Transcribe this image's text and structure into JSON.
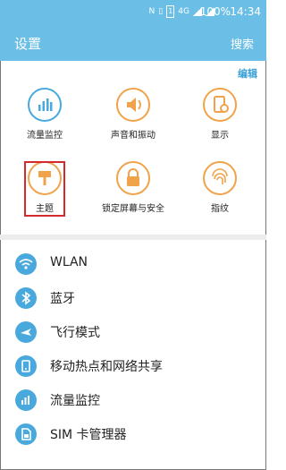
{
  "status_bar": {
    "network_type": "4G",
    "battery": "100%",
    "time": "14:34"
  },
  "header": {
    "title": "设置",
    "search_label": "搜索"
  },
  "top_section": {
    "edit_label": "编辑",
    "tiles": [
      {
        "label": "流量监控",
        "icon": "data-usage-icon",
        "color": "#49a9dd"
      },
      {
        "label": "声音和振动",
        "icon": "speaker-icon",
        "color": "#f0a34a"
      },
      {
        "label": "显示",
        "icon": "display-settings-icon",
        "color": "#f0a34a"
      },
      {
        "label": "主题",
        "icon": "theme-brush-icon",
        "color": "#f0a34a"
      },
      {
        "label": "锁定屏幕与安全",
        "icon": "lock-icon",
        "color": "#f0a34a"
      },
      {
        "label": "指纹",
        "icon": "fingerprint-icon",
        "color": "#f0a34a"
      }
    ]
  },
  "list": [
    {
      "label": "WLAN",
      "icon": "wifi-icon"
    },
    {
      "label": "蓝牙",
      "icon": "bluetooth-icon"
    },
    {
      "label": "飞行模式",
      "icon": "airplane-icon"
    },
    {
      "label": "移动热点和网络共享",
      "icon": "hotspot-icon"
    },
    {
      "label": "流量监控",
      "icon": "data-usage-icon"
    },
    {
      "label": "SIM 卡管理器",
      "icon": "sim-card-icon"
    }
  ],
  "colors": {
    "header_bg": "#6bbfe6",
    "accent_blue": "#49a9dd",
    "accent_orange": "#f0a34a",
    "highlight_red": "#d32b2b"
  }
}
